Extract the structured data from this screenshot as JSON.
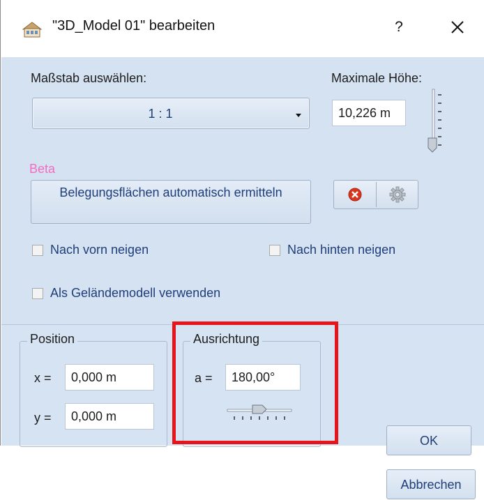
{
  "window": {
    "title": "\"3D_Model 01\" bearbeiten",
    "help_label": "?",
    "icons": {
      "app": "house-icon",
      "close": "close-icon"
    }
  },
  "scale": {
    "label": "Maßstab auswählen:",
    "selected": "1 : 1"
  },
  "height": {
    "label": "Maximale Höhe:",
    "value": "10,226 m",
    "slider_level": 1.0
  },
  "beta": {
    "label": "Beta",
    "auto_button": "Belegungsflächen automatisch ermitteln",
    "icons": [
      "delete-icon",
      "settings-gear-icon"
    ]
  },
  "options": {
    "tilt_front": {
      "label": "Nach vorn neigen",
      "checked": false
    },
    "tilt_back": {
      "label": "Nach hinten neigen",
      "checked": false
    },
    "terrain": {
      "label": "Als Geländemodell verwenden",
      "checked": false
    }
  },
  "position": {
    "title": "Position",
    "x_label": "x =",
    "x_value": "0,000 m",
    "y_label": "y =",
    "y_value": "0,000 m"
  },
  "orientation": {
    "title": "Ausrichtung",
    "a_label": "a =",
    "a_value": "180,00°",
    "slider_level": 0.5
  },
  "buttons": {
    "ok": "OK",
    "cancel": "Abbrechen"
  },
  "colors": {
    "client_bg": "#d5e2f2",
    "accent_text": "#1f3e78",
    "beta": "#f06ec2",
    "highlight": "#e8141c",
    "delete_red": "#d9361d"
  }
}
